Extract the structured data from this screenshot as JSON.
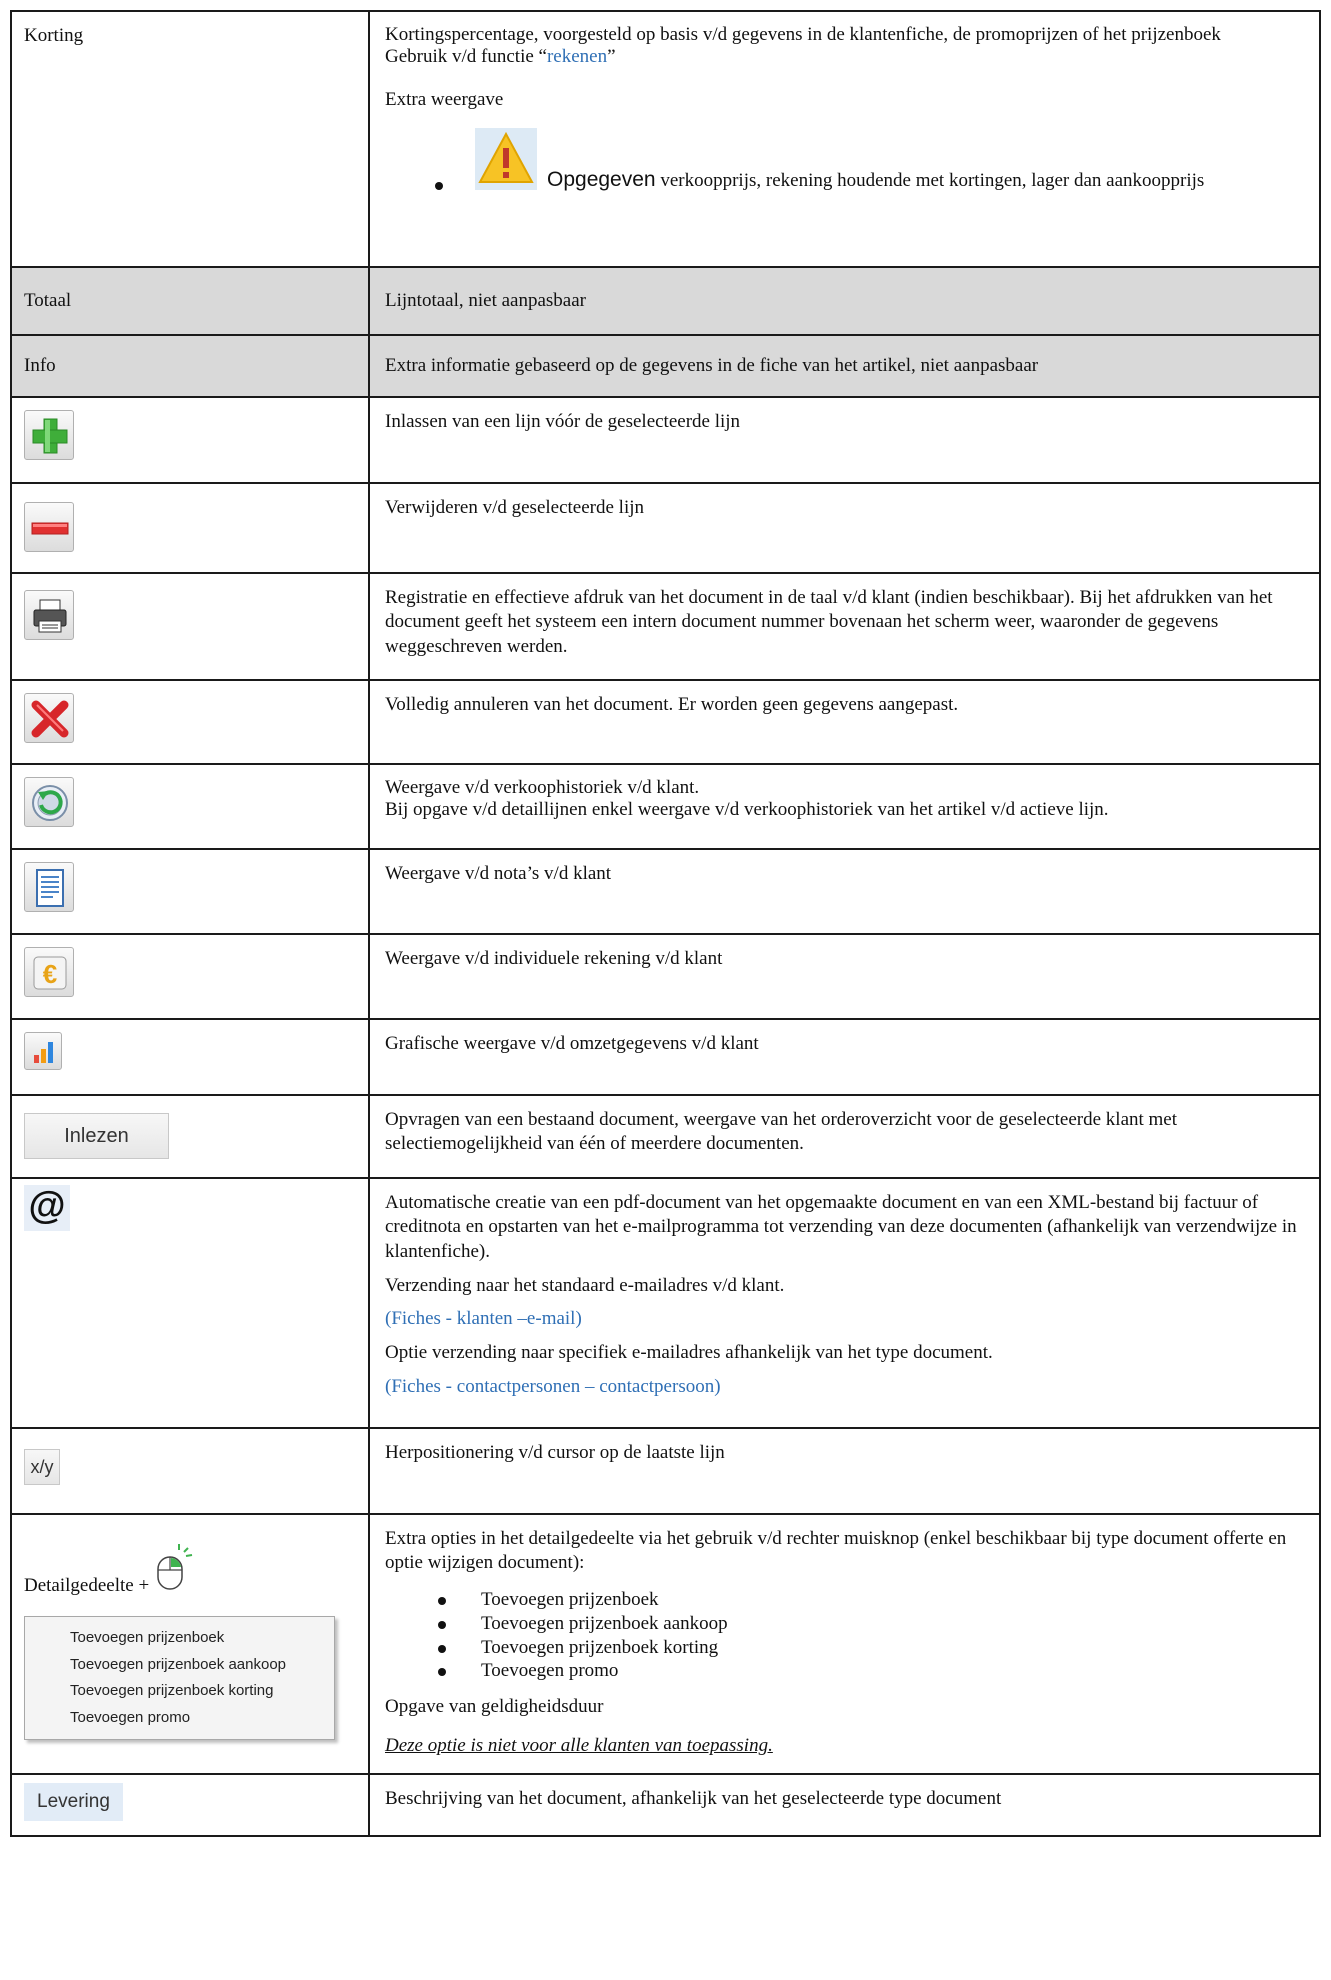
{
  "rows": {
    "korting": {
      "label": "Korting",
      "desc_line1": "Kortingspercentage, voorgesteld op basis v/d gegevens in de klantenfiche, de promoprijzen of het prijzenboek",
      "func_prefix": "Gebruik v/d functie “",
      "func_link": "rekenen",
      "func_suffix": "”",
      "extra_label": "Extra weergave",
      "warn_bold": "Opgegeven",
      "warn_text": " verkoopprijs, rekening houdende met kortingen, lager dan aankoopprijs"
    },
    "totaal": {
      "label": "Totaal",
      "desc": "Lijntotaal, niet aanpasbaar"
    },
    "info": {
      "label": "Info",
      "desc": "Extra informatie gebaseerd op de gegevens in de fiche van het artikel, niet aanpasbaar"
    },
    "add": {
      "desc": "Inlassen van een lijn vóór de geselecteerde lijn"
    },
    "remove": {
      "desc": "Verwijderen v/d geselecteerde lijn"
    },
    "print": {
      "desc": "Registratie en effectieve afdruk van het document in de taal v/d klant (indien beschikbaar). Bij het afdrukken van het document geeft het systeem een intern document nummer bovenaan het scherm weer, waaronder de gegevens weggeschreven werden."
    },
    "cancel": {
      "desc": "Volledig annuleren van het document. Er worden geen gegevens aangepast."
    },
    "history": {
      "desc1": "Weergave v/d verkoophistoriek v/d klant.",
      "desc2": "Bij opgave v/d detaillijnen enkel weergave v/d verkoophistoriek van het artikel v/d actieve lijn."
    },
    "notes": {
      "desc": "Weergave v/d nota’s v/d klant"
    },
    "account": {
      "desc": "Weergave v/d individuele rekening v/d klant"
    },
    "chart": {
      "desc": "Grafische weergave v/d omzetgegevens v/d klant"
    },
    "inlezen": {
      "button": "Inlezen",
      "desc": "Opvragen van een bestaand document, weergave van het orderoverzicht voor de geselecteerde klant met selectiemogelijkheid van één of meerdere documenten."
    },
    "email": {
      "icon_glyph": "@",
      "desc1": "Automatische creatie van een pdf-document van het opgemaakte document en van een XML-bestand bij factuur of creditnota en opstarten van het e-mailprogramma tot verzending van deze documenten (afhankelijk van verzendwijze in klantenfiche).",
      "desc2": "Verzending naar het standaard e-mailadres v/d klant.",
      "link1": "(Fiches - klanten –e-mail)",
      "desc3": "Optie verzending naar specifiek e-mailadres afhankelijk van het type document.",
      "link2": "(Fiches - contactpersonen – contactpersoon)"
    },
    "cursor": {
      "button": "x/y",
      "desc": "Herpositionering v/d cursor op de laatste lijn"
    },
    "detail": {
      "label": "Detailgedeelte +",
      "menu": [
        "Toevoegen prijzenboek",
        "Toevoegen prijzenboek aankoop",
        "Toevoegen prijzenboek korting",
        "Toevoegen promo"
      ],
      "desc": "Extra opties in het detailgedeelte via het gebruik v/d rechter muisknop (enkel beschikbaar bij type document offerte en optie wijzigen document):",
      "bullets": [
        "Toevoegen prijzenboek",
        "Toevoegen prijzenboek aankoop",
        "Toevoegen prijzenboek korting",
        "Toevoegen promo"
      ],
      "validity": "Opgave van geldigheidsduur",
      "note": "Deze optie is niet voor alle klanten van toepassing."
    },
    "levering": {
      "button": "Levering",
      "desc": "Beschrijving van het document, afhankelijk van het geselecteerde type document"
    }
  },
  "colors": {
    "link": "#2f6fb5",
    "shaded_row": "#d9d9d9",
    "border": "#1a1a1a"
  }
}
